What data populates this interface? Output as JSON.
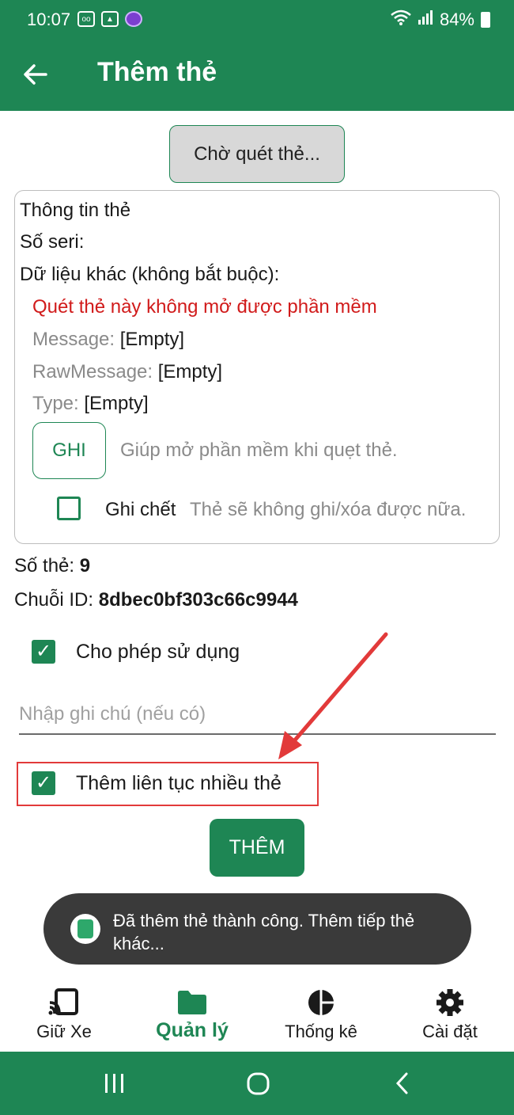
{
  "status": {
    "time": "10:07",
    "battery": "84%"
  },
  "header": {
    "title": "Thêm thẻ"
  },
  "scan_button": "Chờ quét thẻ...",
  "card_info": {
    "heading": "Thông tin thẻ",
    "serial_label": "Số seri:",
    "other_data_label": "Dữ liệu khác (không bắt buộc):",
    "warning": "Quét thẻ này không mở được phần mềm",
    "fields": [
      {
        "key": "Message:",
        "value": "[Empty]"
      },
      {
        "key": "RawMessage:",
        "value": "[Empty]"
      },
      {
        "key": "Type:",
        "value": "[Empty]"
      }
    ],
    "write_button": "GHI",
    "write_hint": "Giúp mở phần mềm khi quẹt thẻ.",
    "lock_label": "Ghi chết",
    "lock_hint": "Thẻ sẽ không ghi/xóa được nữa."
  },
  "card_number": {
    "label": "Số thẻ:",
    "value": "9"
  },
  "chain_id": {
    "label": "Chuỗi ID:",
    "value": "8dbec0bf303c66c9944"
  },
  "allow_use": {
    "label": "Cho phép sử dụng"
  },
  "note": {
    "placeholder": "Nhập ghi chú (nếu có)"
  },
  "continuous": {
    "label": "Thêm liên tục nhiều thẻ"
  },
  "add_button": "THÊM",
  "toast": {
    "line1": "Đã thêm thẻ thành công. Thêm tiếp thẻ",
    "line2": "khác..."
  },
  "bottom_nav": [
    {
      "label": "Giữ Xe",
      "icon": "cast-icon",
      "active": false
    },
    {
      "label": "Quản lý",
      "icon": "folder-icon",
      "active": true
    },
    {
      "label": "Thống kê",
      "icon": "pie-chart-icon",
      "active": false
    },
    {
      "label": "Cài đặt",
      "icon": "gear-icon",
      "active": false
    }
  ],
  "colors": {
    "primary": "#1e8654",
    "warning": "#d11b1b",
    "highlight": "#e23a3a"
  }
}
